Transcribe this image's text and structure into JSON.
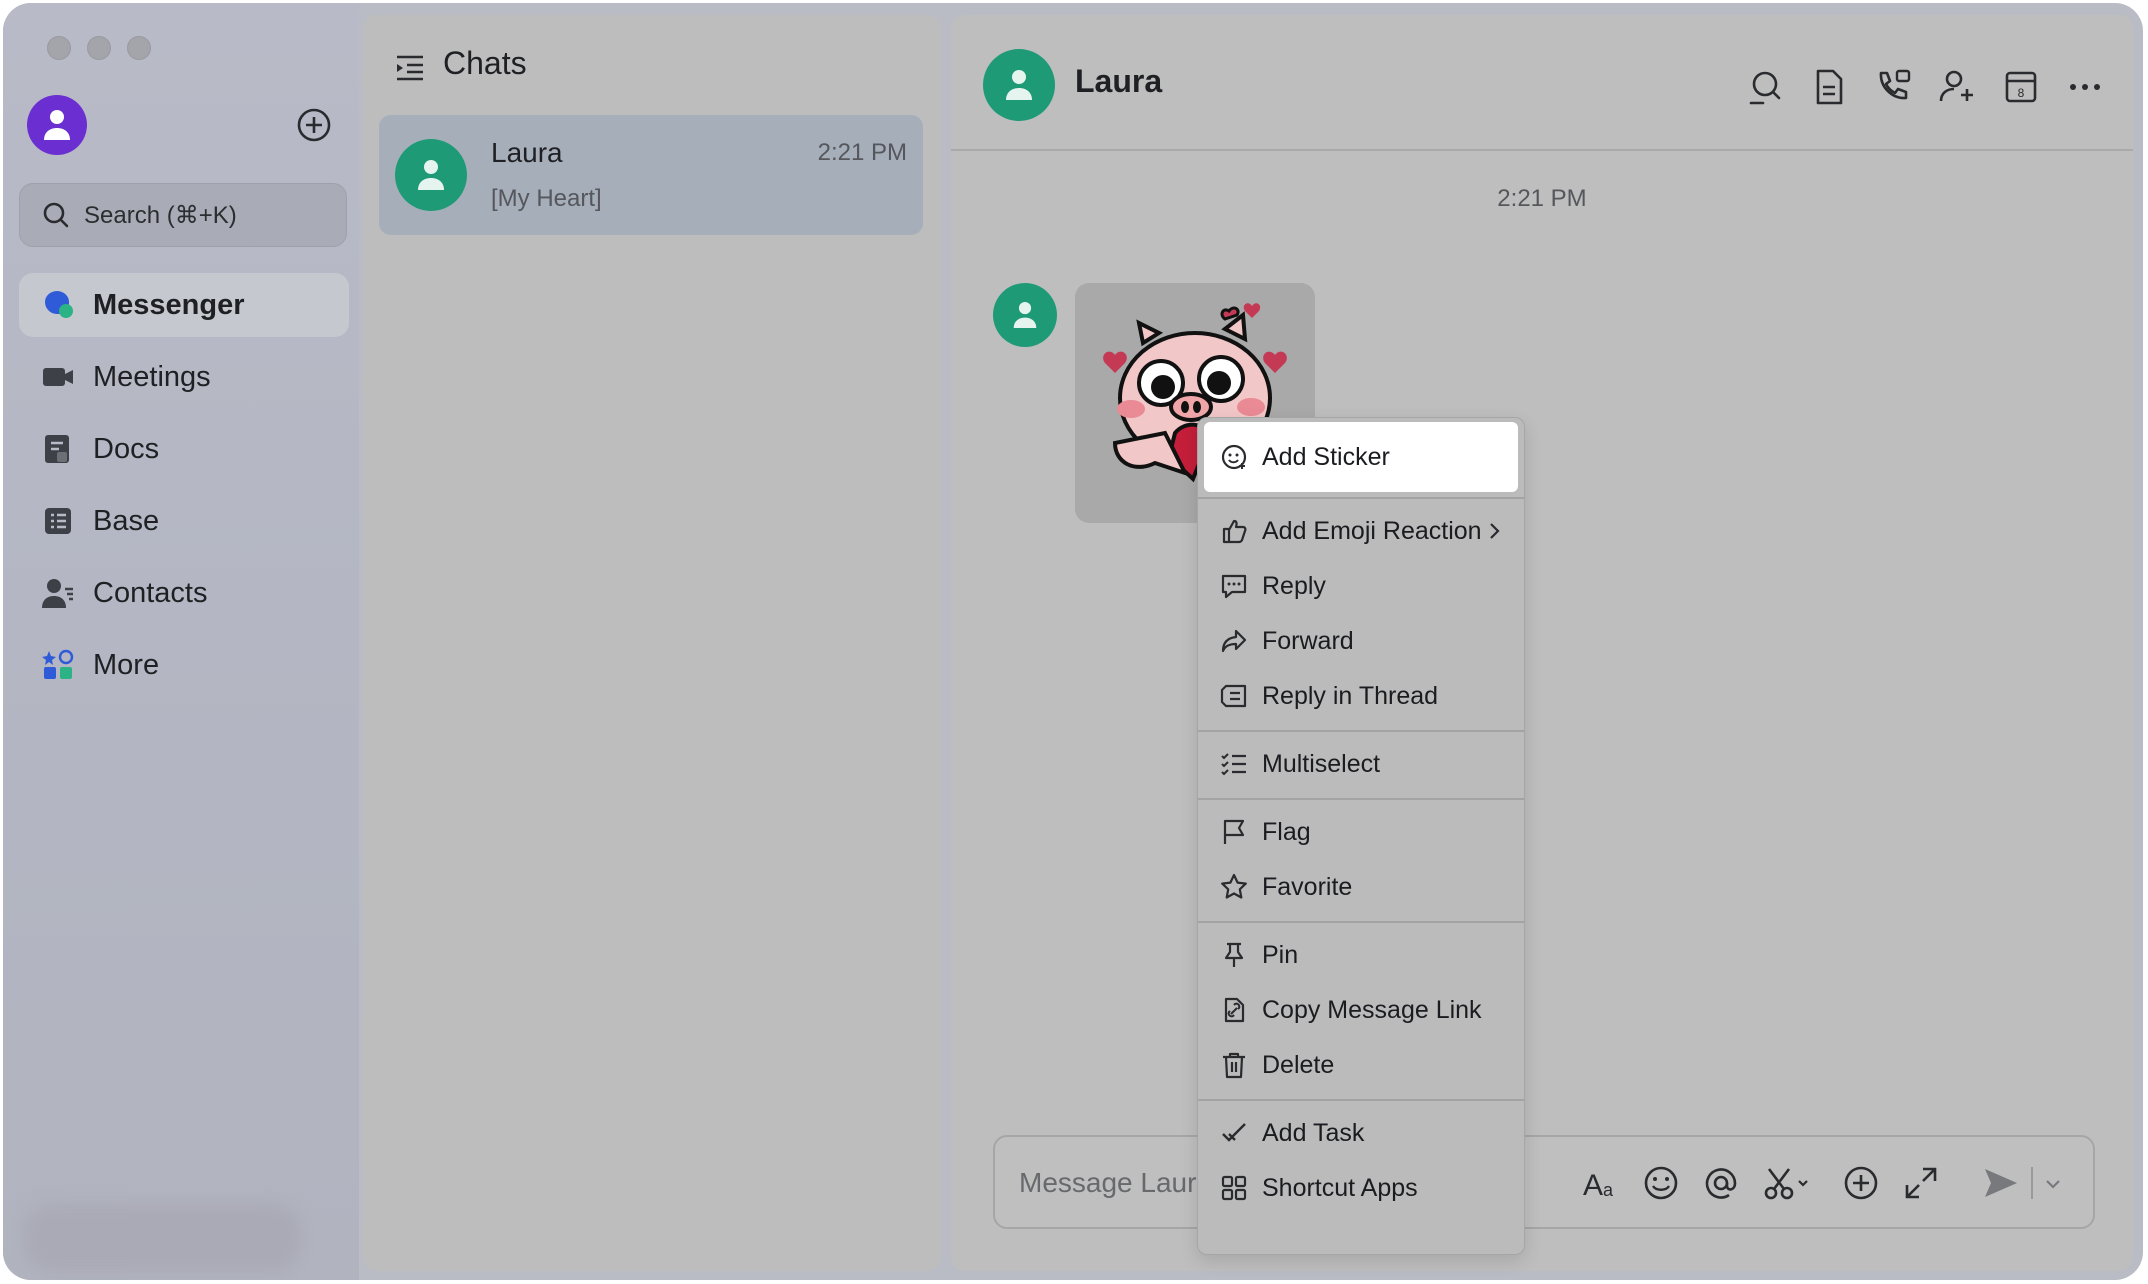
{
  "sidebar": {
    "search_placeholder": "Search (⌘+K)",
    "items": [
      {
        "label": "Messenger",
        "icon": "messenger-icon",
        "active": true
      },
      {
        "label": "Meetings",
        "icon": "video-camera-icon"
      },
      {
        "label": "Docs",
        "icon": "docs-icon"
      },
      {
        "label": "Base",
        "icon": "base-icon"
      },
      {
        "label": "Contacts",
        "icon": "contacts-icon"
      },
      {
        "label": "More",
        "icon": "more-apps-icon"
      }
    ]
  },
  "chatlist": {
    "title": "Chats",
    "chats": [
      {
        "name": "Laura",
        "time": "2:21 PM",
        "preview": "[My Heart]"
      }
    ]
  },
  "conversation": {
    "name": "Laura",
    "message_time": "2:21 PM",
    "input_placeholder": "Message Laura"
  },
  "context_menu": {
    "items": [
      {
        "label": "Add Sticker",
        "icon": "add-sticker-icon",
        "highlighted": true
      },
      {
        "label": "Add Emoji Reaction",
        "icon": "thumbs-up-icon",
        "submenu": true
      },
      {
        "label": "Reply",
        "icon": "reply-icon"
      },
      {
        "label": "Forward",
        "icon": "forward-icon"
      },
      {
        "label": "Reply in Thread",
        "icon": "thread-icon"
      },
      {
        "label": "Multiselect",
        "icon": "multiselect-icon"
      },
      {
        "label": "Flag",
        "icon": "flag-icon"
      },
      {
        "label": "Favorite",
        "icon": "star-icon"
      },
      {
        "label": "Pin",
        "icon": "pin-icon"
      },
      {
        "label": "Copy Message Link",
        "icon": "link-icon"
      },
      {
        "label": "Delete",
        "icon": "trash-icon"
      },
      {
        "label": "Add Task",
        "icon": "task-check-icon"
      },
      {
        "label": "Shortcut Apps",
        "icon": "grid-apps-icon"
      }
    ]
  },
  "colors": {
    "accent_green": "#1f9a77",
    "self_avatar": "#6b2fd1",
    "messenger_blue": "#2f5bd8"
  }
}
